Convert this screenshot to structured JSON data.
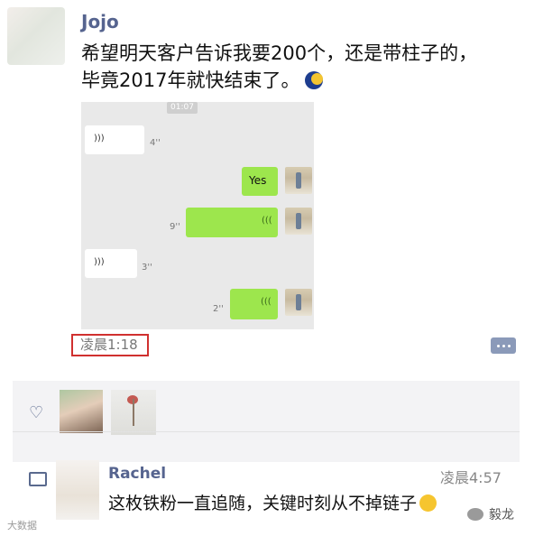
{
  "post": {
    "author": "Jojo",
    "text_line1": "希望明天客户告诉我要200个，还是带柱子的，",
    "text_line2": "毕竟2017年就快结束了。",
    "time": "凌晨1:18"
  },
  "chat_screenshot": {
    "timestamp": "01:07",
    "messages": [
      {
        "side": "in",
        "type": "voice",
        "duration": "4''"
      },
      {
        "side": "out",
        "type": "text",
        "text": "Yes"
      },
      {
        "side": "out",
        "type": "voice",
        "duration": "9''"
      },
      {
        "side": "in",
        "type": "voice",
        "duration": "3''"
      },
      {
        "side": "out",
        "type": "voice",
        "duration": "2''"
      }
    ]
  },
  "comment": {
    "name": "Rachel",
    "time": "凌晨4:57",
    "text": "这枚铁粉一直追随，关键时刻从不掉链子"
  },
  "watermark": {
    "left": "大数据",
    "right": "毅龙"
  },
  "icons": {
    "like": "heart-icon",
    "comment": "comment-bubble-icon",
    "more": "more-comment-icon",
    "moon_emoji": "moon-emoji",
    "grin_emoji": "grin-emoji"
  }
}
